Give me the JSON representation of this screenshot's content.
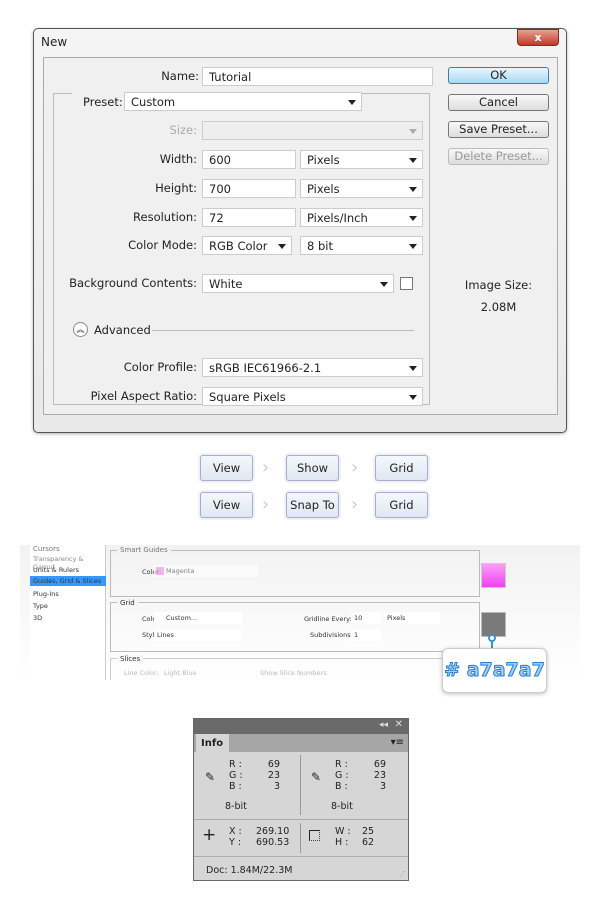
{
  "dialog": {
    "title": "New",
    "close": "x",
    "name_label": "Name:",
    "name_value": "Tutorial",
    "preset_label": "Preset:",
    "preset_value": "Custom",
    "size_label": "Size:",
    "size_value": "",
    "width_label": "Width:",
    "width_value": "600",
    "width_unit": "Pixels",
    "height_label": "Height:",
    "height_value": "700",
    "height_unit": "Pixels",
    "resolution_label": "Resolution:",
    "resolution_value": "72",
    "resolution_unit": "Pixels/Inch",
    "color_mode_label": "Color Mode:",
    "color_mode_value": "RGB Color",
    "bit_depth": "8 bit",
    "background_label": "Background Contents:",
    "background_value": "White",
    "advanced_label": "Advanced",
    "color_profile_label": "Color Profile:",
    "color_profile_value": "sRGB IEC61966-2.1",
    "pixel_aspect_label": "Pixel Aspect Ratio:",
    "pixel_aspect_value": "Square Pixels",
    "buttons": {
      "ok": "OK",
      "cancel": "Cancel",
      "save_preset": "Save Preset...",
      "delete_preset": "Delete Preset..."
    },
    "image_size_label": "Image Size:",
    "image_size_value": "2.08M"
  },
  "paths": [
    [
      "View",
      "Show",
      "Grid"
    ],
    [
      "View",
      "Snap To",
      "Grid"
    ]
  ],
  "prefs": {
    "sidebar": [
      "Cursors",
      "Transparency & Gamut",
      "Units & Rulers",
      "Guides, Grid & Slices",
      "Plug-Ins",
      "Type",
      "3D"
    ],
    "smart_guides_title": "Smart Guides",
    "smart_color_label": "Color:",
    "smart_color_value": "Magenta",
    "grid_title": "Grid",
    "grid_color_label": "Color:",
    "grid_color_value": "Custom...",
    "grid_style_label": "Style:",
    "grid_style_value": "Lines",
    "gridline_label": "Gridline Every:",
    "gridline_value": "10",
    "gridline_unit": "Pixels",
    "subdiv_label": "Subdivisions:",
    "subdiv_value": "1",
    "slices_title": "Slices",
    "line_color_label": "Line Color:",
    "line_color_value": "Light Blue",
    "show_slice_numbers": "Show Slice Numbers",
    "tooltip": "# a7a7a7",
    "grid_swatch_color": "#7a7a7a",
    "magenta_color": "#f060f0"
  },
  "info": {
    "tab": "Info",
    "left": {
      "r_label": "R :",
      "r": "69",
      "g_label": "G :",
      "g": "23",
      "b_label": "B :",
      "b": "3",
      "bit": "8-bit"
    },
    "right": {
      "r_label": "R :",
      "r": "69",
      "g_label": "G :",
      "g": "23",
      "b_label": "B :",
      "b": "3",
      "bit": "8-bit"
    },
    "x_label": "X :",
    "x": "269.10",
    "y_label": "Y :",
    "y": "690.53",
    "w_label": "W :",
    "w": "25",
    "h_label": "H :",
    "h": "62",
    "doc": "Doc: 1.84M/22.3M"
  }
}
